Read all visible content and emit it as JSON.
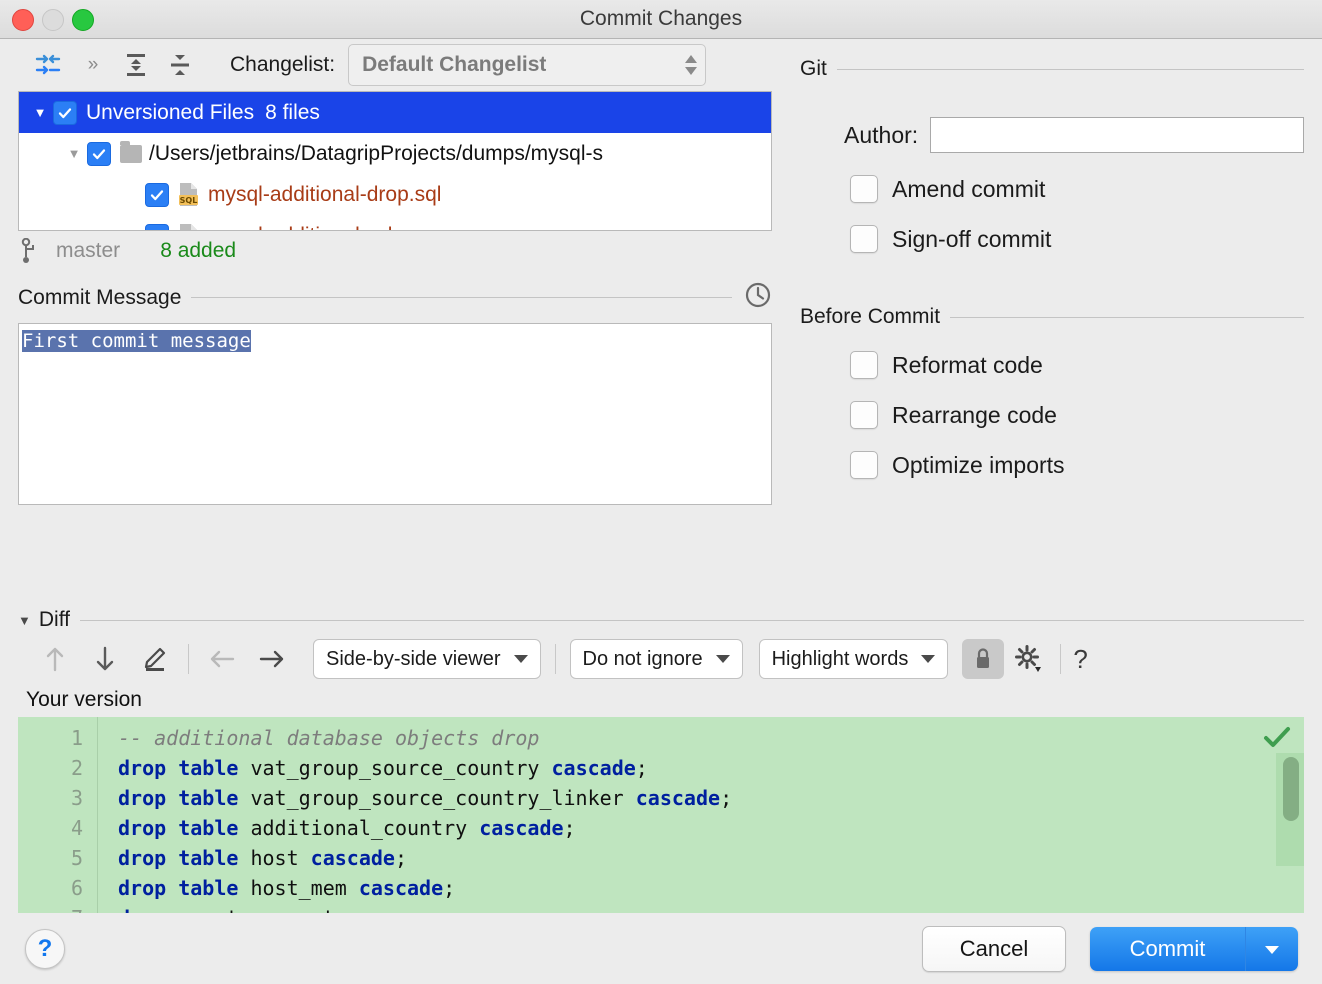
{
  "window": {
    "title": "Commit Changes",
    "traffic": {
      "close": "close-button",
      "minimize": "minimize-button",
      "zoom": "zoom-button"
    }
  },
  "toolbar": {
    "collapse_icon": "collapse-arrows-icon",
    "more_icon": "chevrons-right-icon",
    "expand_all_icon": "expand-all-icon",
    "collapse_all_icon": "collapse-all-icon",
    "changelist_label": "Changelist:",
    "changelist_value": "Default Changelist"
  },
  "tree": {
    "root": {
      "label": "Unversioned Files",
      "count": "8 files",
      "checked": true,
      "expanded": true
    },
    "folder": {
      "path": "/Users/jetbrains/DatagripProjects/dumps/mysql-s",
      "checked": true,
      "expanded": true
    },
    "files": [
      {
        "name": "mysql-additional-drop.sql",
        "checked": true,
        "type": "SQL"
      },
      {
        "name": "mysql-additional.sql",
        "checked": true,
        "type": "SQL"
      }
    ]
  },
  "branch": {
    "icon": "branch-icon",
    "name": "master",
    "added": "8 added"
  },
  "commit_message": {
    "section_title": "Commit Message",
    "history_icon": "clock-history-icon",
    "value": "First commit message",
    "placeholder": ""
  },
  "git": {
    "section_title": "Git",
    "author_label": "Author:",
    "author_value": "",
    "author_placeholder": "",
    "options": [
      {
        "label": "Amend commit",
        "checked": false
      },
      {
        "label": "Sign-off commit",
        "checked": false
      }
    ]
  },
  "before_commit": {
    "section_title": "Before Commit",
    "options": [
      {
        "label": "Reformat code",
        "checked": false
      },
      {
        "label": "Rearrange code",
        "checked": false
      },
      {
        "label": "Optimize imports",
        "checked": false
      }
    ]
  },
  "diff": {
    "section_title": "Diff",
    "toolbar": {
      "prev_icon": "arrow-up-icon",
      "next_icon": "arrow-down-icon",
      "edit_icon": "pencil-icon",
      "apply_left_icon": "arrow-left-icon",
      "apply_right_icon": "arrow-right-icon",
      "viewer_mode": "Side-by-side viewer",
      "ignore_mode": "Do not ignore",
      "highlight_mode": "Highlight words",
      "lock_icon": "lock-icon",
      "settings_icon": "gear-icon",
      "help_icon": "question-mark-icon"
    },
    "pane_label": "Your version",
    "status_icon": "green-check-icon",
    "lines": [
      {
        "num": "1",
        "tokens": [
          {
            "t": "-- additional database objects drop",
            "k": "cmt"
          }
        ]
      },
      {
        "num": "2",
        "tokens": [
          {
            "t": "drop table ",
            "k": "kw"
          },
          {
            "t": "vat_group_source_country ",
            "k": ""
          },
          {
            "t": "cascade",
            "k": "kw"
          },
          {
            "t": ";",
            "k": ""
          }
        ]
      },
      {
        "num": "3",
        "tokens": [
          {
            "t": "drop table ",
            "k": "kw"
          },
          {
            "t": "vat_group_source_country_linker ",
            "k": ""
          },
          {
            "t": "cascade",
            "k": "kw"
          },
          {
            "t": ";",
            "k": ""
          }
        ]
      },
      {
        "num": "4",
        "tokens": [
          {
            "t": "drop table ",
            "k": "kw"
          },
          {
            "t": "additional_country ",
            "k": ""
          },
          {
            "t": "cascade",
            "k": "kw"
          },
          {
            "t": ";",
            "k": ""
          }
        ]
      },
      {
        "num": "5",
        "tokens": [
          {
            "t": "drop table ",
            "k": "kw"
          },
          {
            "t": "host ",
            "k": ""
          },
          {
            "t": "cascade",
            "k": "kw"
          },
          {
            "t": ";",
            "k": ""
          }
        ]
      },
      {
        "num": "6",
        "tokens": [
          {
            "t": "drop table ",
            "k": "kw"
          },
          {
            "t": "host_mem ",
            "k": ""
          },
          {
            "t": "cascade",
            "k": "kw"
          },
          {
            "t": ";",
            "k": ""
          }
        ]
      },
      {
        "num": "7",
        "tokens": [
          {
            "t": "drop ",
            "k": "kw"
          },
          {
            "t": "event myevent;",
            "k": ""
          }
        ]
      }
    ]
  },
  "footer": {
    "help_label": "?",
    "cancel_label": "Cancel",
    "commit_label": "Commit",
    "commit_arrow_icon": "chevron-down-icon"
  },
  "colors": {
    "selection_blue": "#1a44e8",
    "accent_blue": "#1477e8",
    "diff_added_green": "#bfe5bf",
    "added_text_green": "#1a8a1a",
    "file_name_red": "#a83c17",
    "keyword_blue": "#00209f",
    "window_bg": "#ececec"
  }
}
